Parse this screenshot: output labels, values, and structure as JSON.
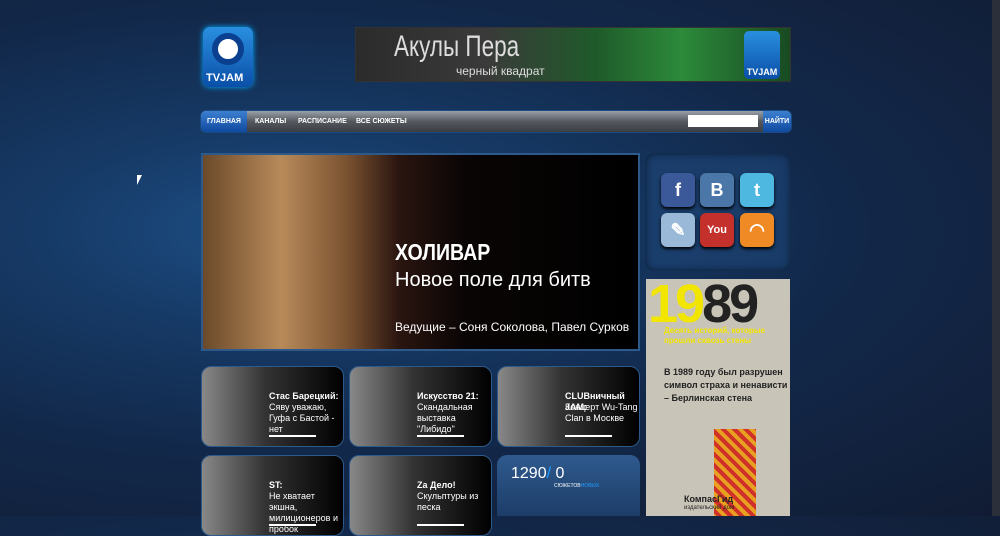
{
  "logo": {
    "text": "TVJAM"
  },
  "banner": {
    "title": "Акулы Пера",
    "subtitle": "черный квадрат",
    "logo_text": "TVJAM"
  },
  "nav": {
    "items": [
      "ГЛАВНАЯ",
      "КАНАЛЫ",
      "РАСПИСАНИЕ",
      "ВСЕ СЮЖЕТЫ"
    ],
    "search_value": "",
    "search_button": "НАЙТИ"
  },
  "hero": {
    "title": "ХОЛИВАР",
    "subtitle": "Новое поле для битв",
    "hosts": "Ведущие – Соня Соколова, Павел Сурков"
  },
  "social": [
    {
      "name": "facebook",
      "glyph": "f",
      "color": "#3b5998"
    },
    {
      "name": "vkontakte",
      "glyph": "B",
      "color": "#4a76a8"
    },
    {
      "name": "twitter",
      "glyph": "t",
      "color": "#4fb8e0"
    },
    {
      "name": "livejournal",
      "glyph": "✎",
      "color": "#9ab8d8"
    },
    {
      "name": "youtube",
      "glyph": "You",
      "color": "#c4302b"
    },
    {
      "name": "rss",
      "glyph": "◠",
      "color": "#f08a24"
    }
  ],
  "ad": {
    "year_a": "19",
    "year_b": "89",
    "subtitle": "Десять историй, которые прошли сквозь стены",
    "text": "В 1989 году был разрушен символ страха и ненависти – Берлинская стена",
    "publisher": "КомпасГид",
    "publisher_sub": "издательский дом"
  },
  "tiles": [
    {
      "title": "Стас Барецкий:",
      "desc": "Сяву уважаю, Гуфа с Бастой - нет"
    },
    {
      "title": "Искусство 21:",
      "desc": "Скандальная выставка \"Либидо\""
    },
    {
      "title": "CLUBничный JAM:",
      "desc": "Концерт Wu-Tang Clan в Москве"
    },
    {
      "title": "ST:",
      "desc": "Не хватает экшна, милиционеров и пробок"
    },
    {
      "title": "Za Дело!",
      "desc": "Скульптуры из песка"
    }
  ],
  "counter": {
    "total": "1290",
    "sep": "/",
    "new": " 0",
    "label_a": "СЮЖЕТОВ",
    "label_b": "НОВЫХ"
  }
}
